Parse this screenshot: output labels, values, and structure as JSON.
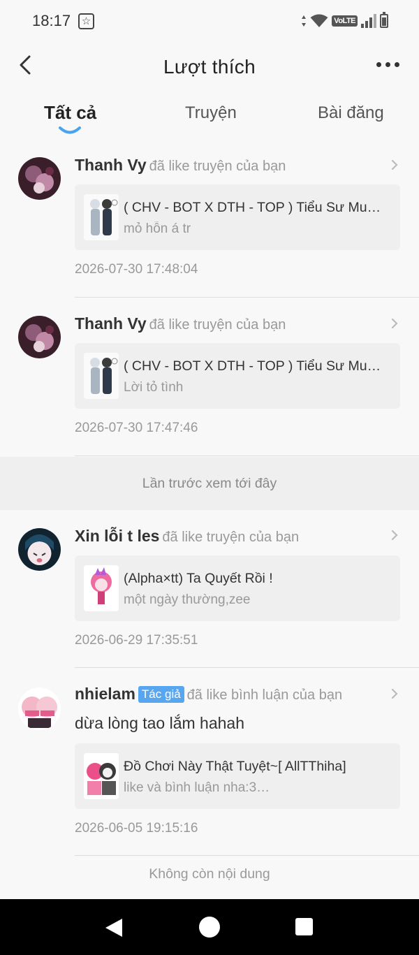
{
  "status_bar": {
    "time": "18:17",
    "app_icon": "star-badge-icon",
    "network_label": "VoLTE",
    "icons": [
      "data-arrows-icon",
      "wifi-icon",
      "volte-icon",
      "signal-icon",
      "battery-icon"
    ]
  },
  "header": {
    "title": "Lượt thích",
    "back_icon": "chevron-left-icon",
    "more_icon": "more-horizontal-icon"
  },
  "tabs": [
    {
      "label": "Tất cả",
      "active": true
    },
    {
      "label": "Truyện",
      "active": false
    },
    {
      "label": "Bài đăng",
      "active": false
    }
  ],
  "colors": {
    "accent": "#4aa3ee",
    "badge": "#58a6ef",
    "background": "#f8f8f8",
    "card": "#efefef"
  },
  "notifications": [
    {
      "user": "Thanh Vy",
      "action": "đã like truyện của bạn",
      "card_title": "( CHV - BOT X DTH - TOP ) Tiểu Sư Muội Ngọc Nộm",
      "card_subtitle": "mỏ hỗn á tr",
      "timestamp": "2026-07-30 17:48:04"
    },
    {
      "user": "Thanh Vy",
      "action": "đã like truyện của bạn",
      "card_title": "( CHV - BOT X DTH - TOP ) Tiểu Sư Muội Ngọc Nộm",
      "card_subtitle": "Lời tỏ tình",
      "timestamp": "2026-07-30 17:47:46"
    },
    {
      "user": "Xin lỗi t les",
      "action": "đã like truyện của bạn",
      "card_title": "(Alpha×tt) Ta Quyết Rồi !",
      "card_subtitle": "một ngày thường,zee",
      "timestamp": "2026-06-29 17:35:51"
    },
    {
      "user": "nhielam",
      "badge": "Tác giả",
      "action": "đã like bình luận của bạn",
      "comment": "dừa lòng tao lắm hahah",
      "card_title": "Đồ Chơi Này Thật Tuyệt~[ AllTThiha]",
      "card_subtitle": "like và bình luận nha:3…",
      "timestamp": "2026-06-05 19:15:16"
    }
  ],
  "last_seen_label": "Lần trước xem tới đây",
  "end_label": "Không còn nội dung",
  "nav_bar": {
    "icons": [
      "nav-back-icon",
      "nav-home-icon",
      "nav-recents-icon"
    ]
  }
}
